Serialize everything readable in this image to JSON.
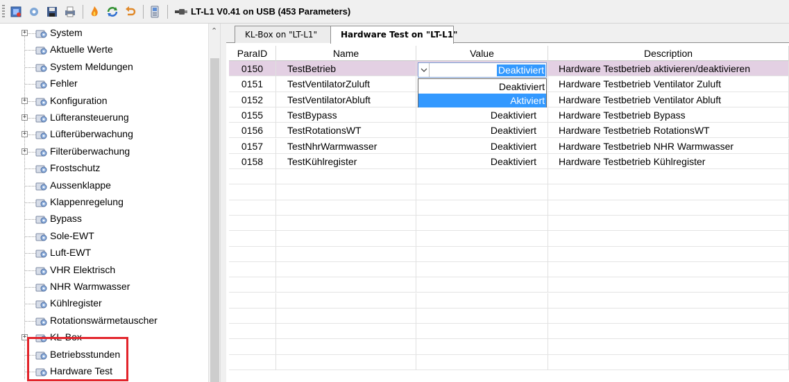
{
  "toolbar": {
    "title": "LT-L1 V0.41 on USB (453 Parameters)",
    "buttons": [
      "connect-icon",
      "settings-icon",
      "save-icon",
      "print-icon",
      "flame-icon",
      "refresh-icon",
      "undo-icon",
      "device-icon"
    ]
  },
  "tree": {
    "items": [
      {
        "label": "System",
        "expandable": true
      },
      {
        "label": "Aktuelle Werte",
        "expandable": false
      },
      {
        "label": "System Meldungen",
        "expandable": false
      },
      {
        "label": "Fehler",
        "expandable": false
      },
      {
        "label": "Konfiguration",
        "expandable": true
      },
      {
        "label": "Lüfteransteuerung",
        "expandable": true
      },
      {
        "label": "Lüfterüberwachung",
        "expandable": true
      },
      {
        "label": "Filterüberwachung",
        "expandable": true
      },
      {
        "label": "Frostschutz",
        "expandable": false
      },
      {
        "label": "Aussenklappe",
        "expandable": false
      },
      {
        "label": "Klappenregelung",
        "expandable": false
      },
      {
        "label": "Bypass",
        "expandable": false
      },
      {
        "label": "Sole-EWT",
        "expandable": false
      },
      {
        "label": "Luft-EWT",
        "expandable": false
      },
      {
        "label": "VHR Elektrisch",
        "expandable": false
      },
      {
        "label": "NHR Warmwasser",
        "expandable": false
      },
      {
        "label": "Kühlregister",
        "expandable": false
      },
      {
        "label": "Rotationswärmetauscher",
        "expandable": false
      },
      {
        "label": "KL-Box",
        "expandable": true
      },
      {
        "label": "Betriebsstunden",
        "expandable": false
      },
      {
        "label": "Hardware Test",
        "expandable": false
      }
    ],
    "highlight_color": "#e2232a"
  },
  "tabs": [
    {
      "label": "KL-Box on \"LT-L1\"",
      "active": false
    },
    {
      "label": "Hardware Test on \"LT-L1\"",
      "active": true
    }
  ],
  "grid": {
    "headers": {
      "id": "ParaID",
      "name": "Name",
      "value": "Value",
      "description": "Description"
    },
    "rows": [
      {
        "id": "0150",
        "name": "TestBetrieb",
        "value": "Deaktiviert",
        "description": "Hardware Testbetrieb aktivieren/deaktivieren",
        "selected": true
      },
      {
        "id": "0151",
        "name": "TestVentilatorZuluft",
        "value": "",
        "description": "Hardware Testbetrieb Ventilator Zuluft",
        "selected": false
      },
      {
        "id": "0152",
        "name": "TestVentilatorAbluft",
        "value": "",
        "description": "Hardware Testbetrieb Ventilator Abluft",
        "selected": false
      },
      {
        "id": "0155",
        "name": "TestBypass",
        "value": "Deaktiviert",
        "description": "Hardware Testbetrieb Bypass",
        "selected": false
      },
      {
        "id": "0156",
        "name": "TestRotationsWT",
        "value": "Deaktiviert",
        "description": "Hardware Testbetrieb RotationsWT",
        "selected": false
      },
      {
        "id": "0157",
        "name": "TestNhrWarmwasser",
        "value": "Deaktiviert",
        "description": "Hardware Testbetrieb NHR Warmwasser",
        "selected": false
      },
      {
        "id": "0158",
        "name": "TestKühlregister",
        "value": "Deaktiviert",
        "description": "Hardware Testbetrieb Kühlregister",
        "selected": false
      }
    ],
    "empty_rows": 13,
    "selected_row_color": "#e3d0e3"
  },
  "combo": {
    "value": "Deaktiviert",
    "options": [
      {
        "label": "Deaktiviert",
        "hover": false
      },
      {
        "label": "Aktiviert",
        "hover": true
      }
    ],
    "accent": "#3399ff"
  }
}
